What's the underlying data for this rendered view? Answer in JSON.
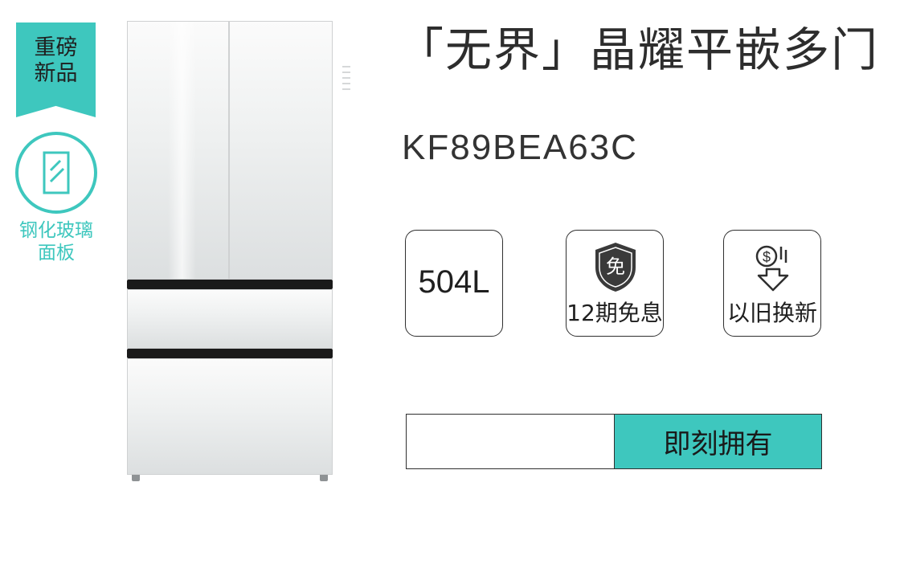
{
  "badges": {
    "new_product": [
      "重磅",
      "新品"
    ],
    "glass_panel": [
      "钢化玻璃",
      "面板"
    ]
  },
  "product": {
    "title": "「无界」晶耀平嵌多门",
    "model": "KF89BEA63C"
  },
  "features": [
    {
      "value": "504L",
      "label": ""
    },
    {
      "icon": "shield-mian-icon",
      "icon_text": "免",
      "label": "12期免息"
    },
    {
      "icon": "trade-in-icon",
      "label": "以旧换新"
    }
  ],
  "cta": {
    "label": "即刻拥有"
  },
  "colors": {
    "accent": "#3ec7be",
    "text": "#2b2b2b",
    "border": "#2f2f2f"
  }
}
